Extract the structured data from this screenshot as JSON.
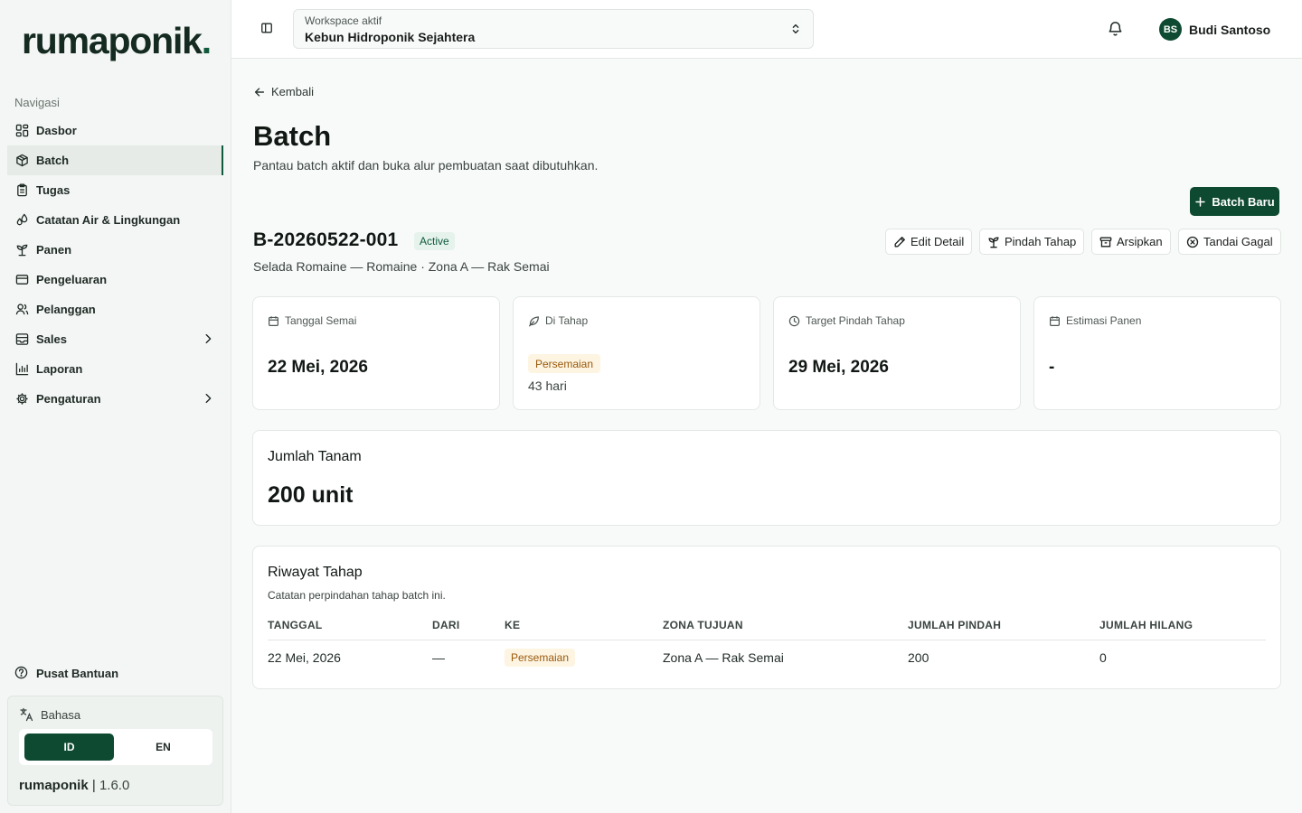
{
  "sidebar": {
    "logo": "rumaponik",
    "logo_dot": ".",
    "nav_caption": "Navigasi",
    "items": [
      {
        "label": "Dasbor"
      },
      {
        "label": "Batch"
      },
      {
        "label": "Tugas"
      },
      {
        "label": "Catatan Air & Lingkungan"
      },
      {
        "label": "Panen"
      },
      {
        "label": "Pengeluaran"
      },
      {
        "label": "Pelanggan"
      },
      {
        "label": "Sales"
      },
      {
        "label": "Laporan"
      },
      {
        "label": "Pengaturan"
      }
    ],
    "help": "Pusat Bantuan",
    "language": {
      "title": "Bahasa",
      "id": "ID",
      "en": "EN"
    },
    "app_name": "rumaponik",
    "separator": "|",
    "version": "1.6.0"
  },
  "topbar": {
    "workspace_label": "Workspace aktif",
    "workspace_name": "Kebun Hidroponik Sejahtera",
    "user_initials": "BS",
    "user_name": "Budi Santoso"
  },
  "page": {
    "back": "Kembali",
    "title": "Batch",
    "subtitle": "Pantau batch aktif dan buka alur pembuatan saat dibutuhkan.",
    "new_button": "Batch Baru"
  },
  "batch": {
    "code": "B-20260522-001",
    "status": "Active",
    "subtitle": "Selada Romaine — Romaine · Zona A — Rak Semai",
    "actions": {
      "edit": "Edit Detail",
      "move": "Pindah Tahap",
      "archive": "Arsipkan",
      "fail": "Tandai Gagal"
    }
  },
  "stats": {
    "sow_date": {
      "label": "Tanggal Semai",
      "value": "22 Mei, 2026"
    },
    "stage": {
      "label": "Di Tahap",
      "value": "Persemaian",
      "days": "43 hari"
    },
    "target": {
      "label": "Target Pindah Tahap",
      "value": "29 Mei, 2026"
    },
    "harvest": {
      "label": "Estimasi Panen",
      "value": "-"
    }
  },
  "quantity": {
    "title": "Jumlah Tanam",
    "value": "200 unit"
  },
  "history": {
    "title": "Riwayat Tahap",
    "subtitle": "Catatan perpindahan tahap batch ini.",
    "columns": [
      "TANGGAL",
      "DARI",
      "KE",
      "ZONA TUJUAN",
      "JUMLAH PINDAH",
      "JUMLAH HILANG"
    ],
    "rows": [
      [
        "22 Mei, 2026",
        "—",
        "Persemaian",
        "Zona A — Rak Semai",
        "200",
        "0"
      ]
    ]
  },
  "colors": {
    "brand": "#0e4a31",
    "active_badge_bg": "#e6f2ec",
    "stage_badge_bg": "#fdf4e2",
    "stage_badge_text": "#9a5a0c"
  }
}
